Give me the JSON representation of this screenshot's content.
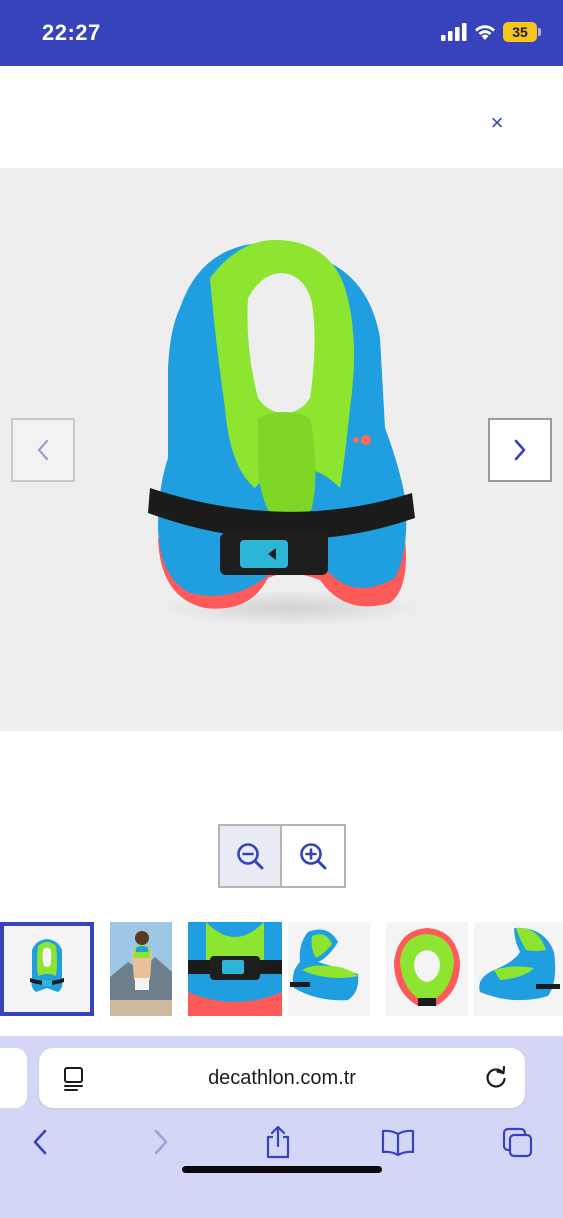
{
  "status_bar": {
    "time": "22:27",
    "battery_level": "35"
  },
  "viewer": {
    "close_label": "×",
    "main_image": "swim-vest-product-photo",
    "prev_icon": "chevron-left-icon",
    "next_icon": "chevron-right-icon"
  },
  "zoom": {
    "out_icon": "zoom-out-icon",
    "in_icon": "zoom-in-icon"
  },
  "thumbnails": [
    {
      "name": "thumb-vest-front",
      "selected": true
    },
    {
      "name": "thumb-child-wearing-vest",
      "selected": false
    },
    {
      "name": "thumb-buckle-closeup",
      "selected": false
    },
    {
      "name": "thumb-vest-side",
      "selected": false
    },
    {
      "name": "thumb-vest-top",
      "selected": false
    },
    {
      "name": "thumb-vest-back-logo",
      "selected": false
    }
  ],
  "browser": {
    "url": "decathlon.com.tr",
    "toolbar": [
      "back-icon",
      "forward-icon",
      "share-icon",
      "bookmarks-icon",
      "tabs-icon"
    ]
  },
  "colors": {
    "brand": "#3643ba",
    "vest_blue": "#1f9ee0",
    "vest_green": "#8ee52f",
    "vest_coral": "#ff5a5a"
  }
}
